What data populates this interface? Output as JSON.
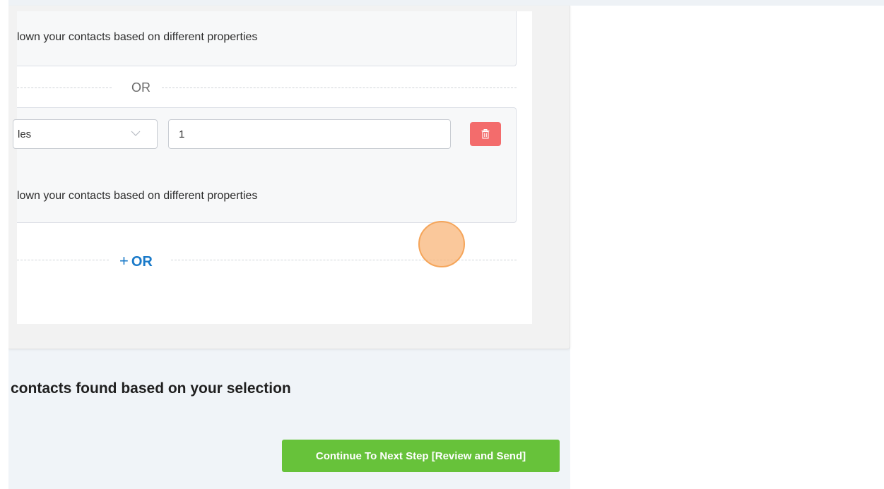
{
  "conditions": {
    "group1": {
      "description": "lown your contacts based on different properties"
    },
    "separator_label": "OR",
    "group2": {
      "field_select_value": "les",
      "value_input": "1",
      "description": "lown your contacts based on different properties"
    },
    "add_or": {
      "plus": "+",
      "label": "OR"
    }
  },
  "result": {
    "text": "contacts found based on your selection"
  },
  "actions": {
    "continue_label": "Continue To Next Step [Review and Send]"
  },
  "colors": {
    "delete_red": "#f36c6c",
    "continue_green": "#67c23a",
    "link_blue": "#1a7ac9",
    "cursor_orange": "#f5a55a"
  },
  "icons": {
    "delete": "trash-icon",
    "select_arrow": "chevron-down-icon"
  }
}
